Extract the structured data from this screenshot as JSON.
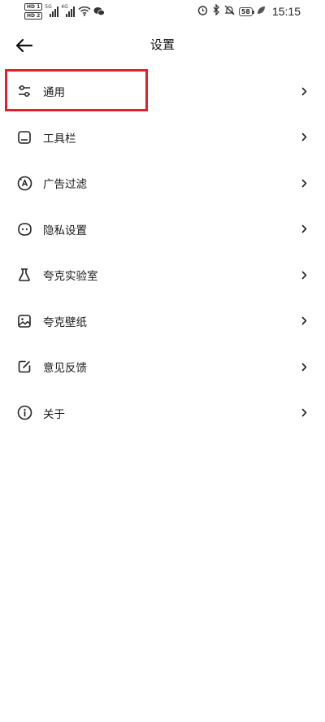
{
  "status_bar": {
    "hd1": "HD 1",
    "hd2": "HD 2",
    "sig1_gen": "5G",
    "sig2_gen": "4G",
    "battery": "58",
    "time": "15:15"
  },
  "header": {
    "title": "设置"
  },
  "menu": {
    "items": [
      {
        "label": "通用",
        "icon": "sliders-icon"
      },
      {
        "label": "工具栏",
        "icon": "toolbar-icon"
      },
      {
        "label": "广告过滤",
        "icon": "ad-filter-icon"
      },
      {
        "label": "隐私设置",
        "icon": "privacy-icon"
      },
      {
        "label": "夸克实验室",
        "icon": "flask-icon"
      },
      {
        "label": "夸克壁纸",
        "icon": "wallpaper-icon"
      },
      {
        "label": "意见反馈",
        "icon": "feedback-icon"
      },
      {
        "label": "关于",
        "icon": "info-icon"
      }
    ]
  },
  "highlight": {
    "color": "#e0202a",
    "target": "通用"
  }
}
